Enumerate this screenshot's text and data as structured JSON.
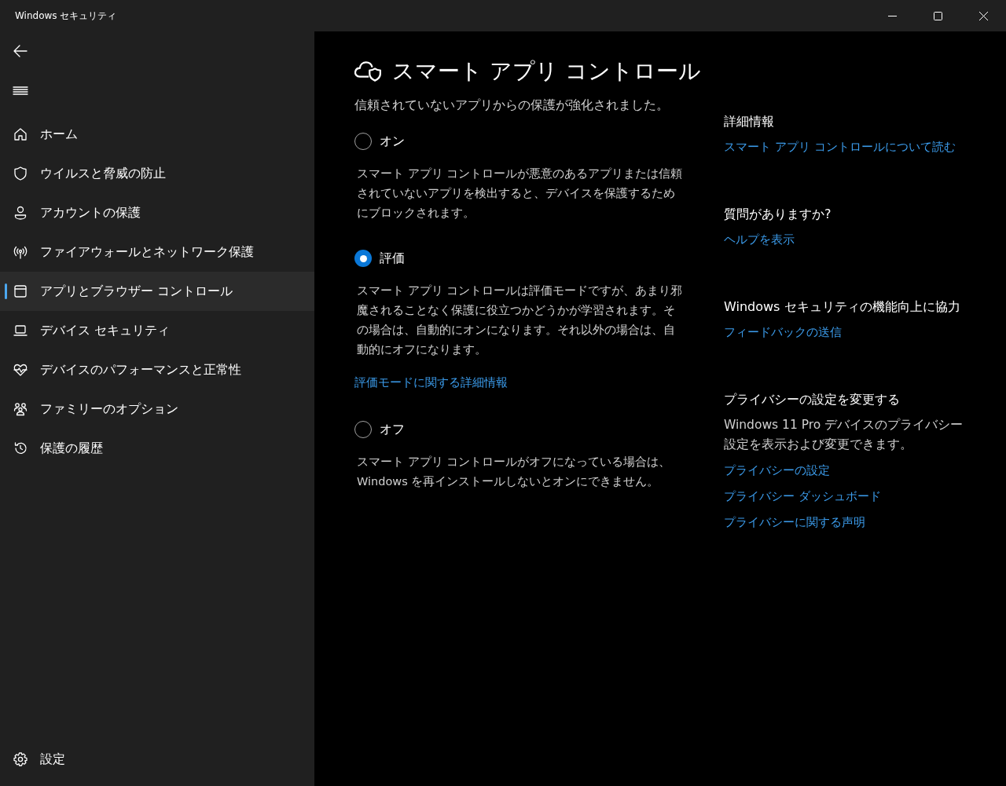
{
  "window": {
    "title": "Windows セキュリティ"
  },
  "sidebar": {
    "items": [
      {
        "label": "ホーム",
        "selected": false
      },
      {
        "label": "ウイルスと脅威の防止",
        "selected": false
      },
      {
        "label": "アカウントの保護",
        "selected": false
      },
      {
        "label": "ファイアウォールとネットワーク保護",
        "selected": false
      },
      {
        "label": "アプリとブラウザー コントロール",
        "selected": true
      },
      {
        "label": "デバイス セキュリティ",
        "selected": false
      },
      {
        "label": "デバイスのパフォーマンスと正常性",
        "selected": false
      },
      {
        "label": "ファミリーのオプション",
        "selected": false
      },
      {
        "label": "保護の履歴",
        "selected": false
      }
    ],
    "settings": "設定"
  },
  "page": {
    "title": "スマート アプリ コントロール",
    "subtitle": "信頼されていないアプリからの保護が強化されました。",
    "options": [
      {
        "label": "オン",
        "selected": false,
        "description": "スマート アプリ コントロールが悪意のあるアプリまたは信頼されていないアプリを検出すると、デバイスを保護するためにブロックされます。"
      },
      {
        "label": "評価",
        "selected": true,
        "description": "スマート アプリ コントロールは評価モードですが、あまり邪魔されることなく保護に役立つかどうかが学習されます。その場合は、自動的にオンになります。それ以外の場合は、自動的にオフになります。",
        "link": "評価モードに関する詳細情報"
      },
      {
        "label": "オフ",
        "selected": false,
        "description": "スマート アプリ コントロールがオフになっている場合は、Windows を再インストールしないとオンにできません。"
      }
    ]
  },
  "side_panel": [
    {
      "heading": "詳細情報",
      "links": [
        "スマート アプリ コントロールについて読む"
      ]
    },
    {
      "heading": "質問がありますか?",
      "links": [
        "ヘルプを表示"
      ]
    },
    {
      "heading": "Windows セキュリティの機能向上に協力",
      "links": [
        "フィードバックの送信"
      ]
    },
    {
      "heading": "プライバシーの設定を変更する",
      "text": "Windows 11 Pro デバイスのプライバシー設定を表示および変更できます。",
      "links": [
        "プライバシーの設定",
        "プライバシー ダッシュボード",
        "プライバシーに関する声明"
      ]
    }
  ]
}
